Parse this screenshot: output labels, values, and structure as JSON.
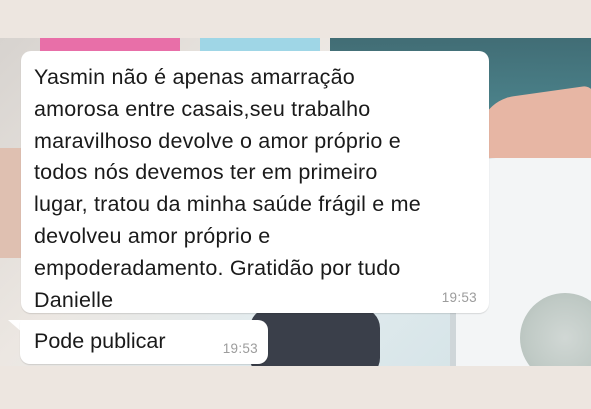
{
  "messages": [
    {
      "text": "Yasmin não é apenas amarração\namorosa entre casais,seu trabalho\nmaravilhoso devolve o  amor próprio e\ntodos nós devemos ter em primeiro\nlugar, tratou da minha saúde frágil e me\ndevolveu amor próprio e\nempoderadamento. Gratidão por tudo\nDanielle",
      "time": "19:53"
    },
    {
      "text": "Pode publicar",
      "time": "19:53"
    }
  ],
  "colors": {
    "bubble": "#ffffff",
    "timestamp": "#9c9c9c",
    "frame": "#ede6e0"
  }
}
